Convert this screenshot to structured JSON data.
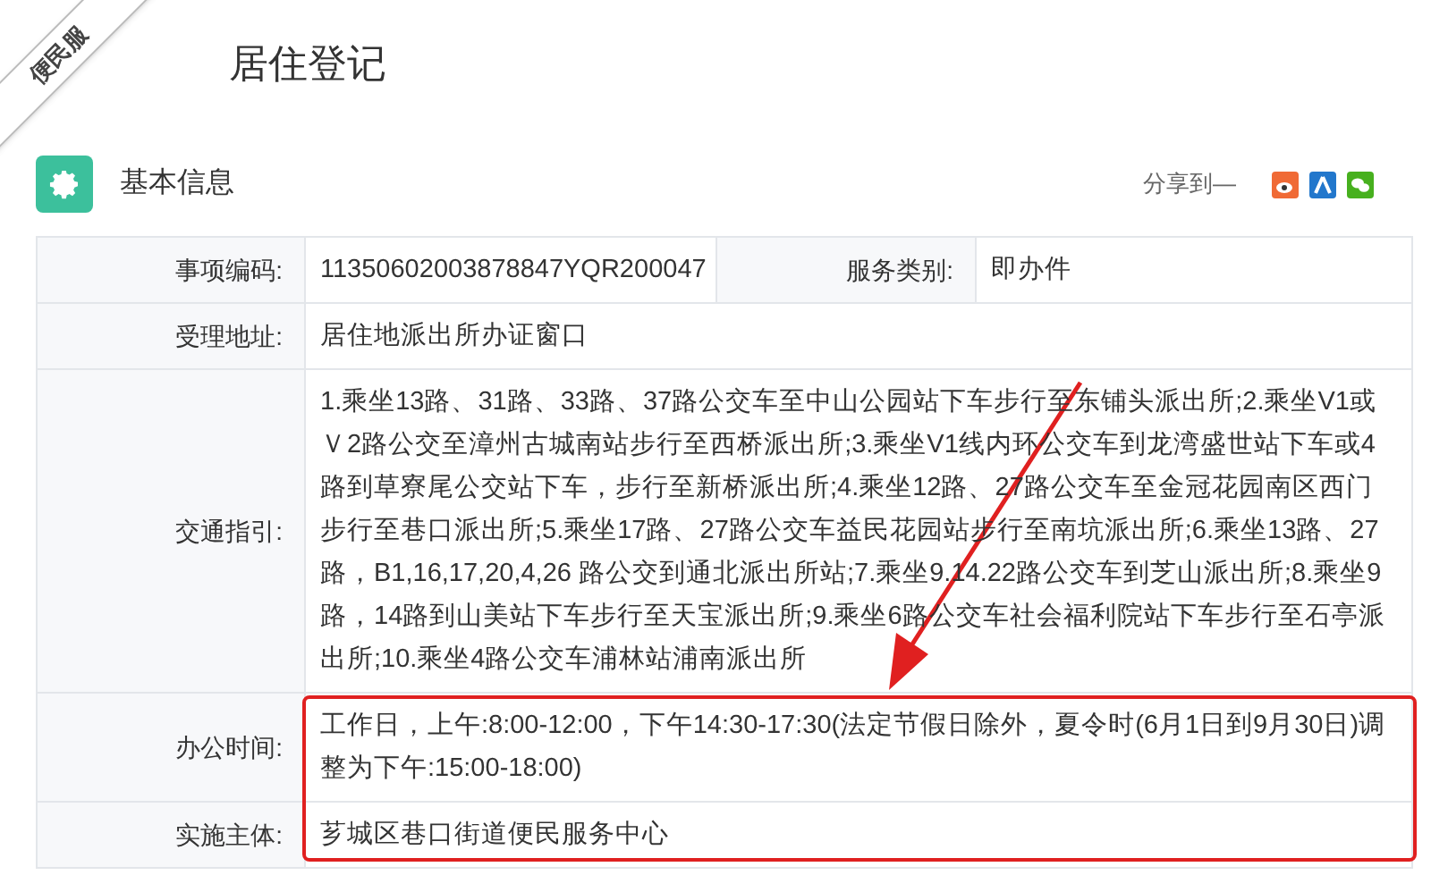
{
  "ribbon": {
    "text": "便民服"
  },
  "title": "居住登记",
  "section": {
    "title": "基本信息",
    "share_label": "分享到—"
  },
  "rows": [
    {
      "cells": [
        {
          "label": "事项编码:",
          "value": "11350602003878847YQR200047"
        },
        {
          "label": "服务类别:",
          "value": "即办件"
        }
      ]
    },
    {
      "cells": [
        {
          "label": "受理地址:",
          "value": "居住地派出所办证窗口"
        }
      ]
    },
    {
      "cells": [
        {
          "label": "交通指引:",
          "value": "1.乘坐13路、31路、33路、37路公交车至中山公园站下车步行至东铺头派出所;2.乘坐V1或Ｖ2路公交至漳州古城南站步行至西桥派出所;3.乘坐V1线内环公交车到龙湾盛世站下车或4路到草寮尾公交站下车，步行至新桥派出所;4.乘坐12路、27路公交车至金冠花园南区西门步行至巷口派出所;5.乘坐17路、27路公交车益民花园站步行至南坑派出所;6.乘坐13路、27路，B1,16,17,20,4,26 路公交到通北派出所站;7.乘坐9.14.22路公交车到芝山派出所;8.乘坐9路，14路到山美站下车步行至天宝派出所;9.乘坐6路公交车社会福利院站下车步行至石亭派出所;10.乘坐4路公交车浦林站浦南派出所"
        }
      ]
    },
    {
      "cells": [
        {
          "label": "办公时间:",
          "value": "工作日，上午:8:00-12:00，下午14:30-17:30(法定节假日除外，夏令时(6月1日到9月30日)调整为下午:15:00-18:00)"
        }
      ]
    },
    {
      "cells": [
        {
          "label": "实施主体:",
          "value": "芗城区巷口街道便民服务中心"
        }
      ]
    }
  ]
}
